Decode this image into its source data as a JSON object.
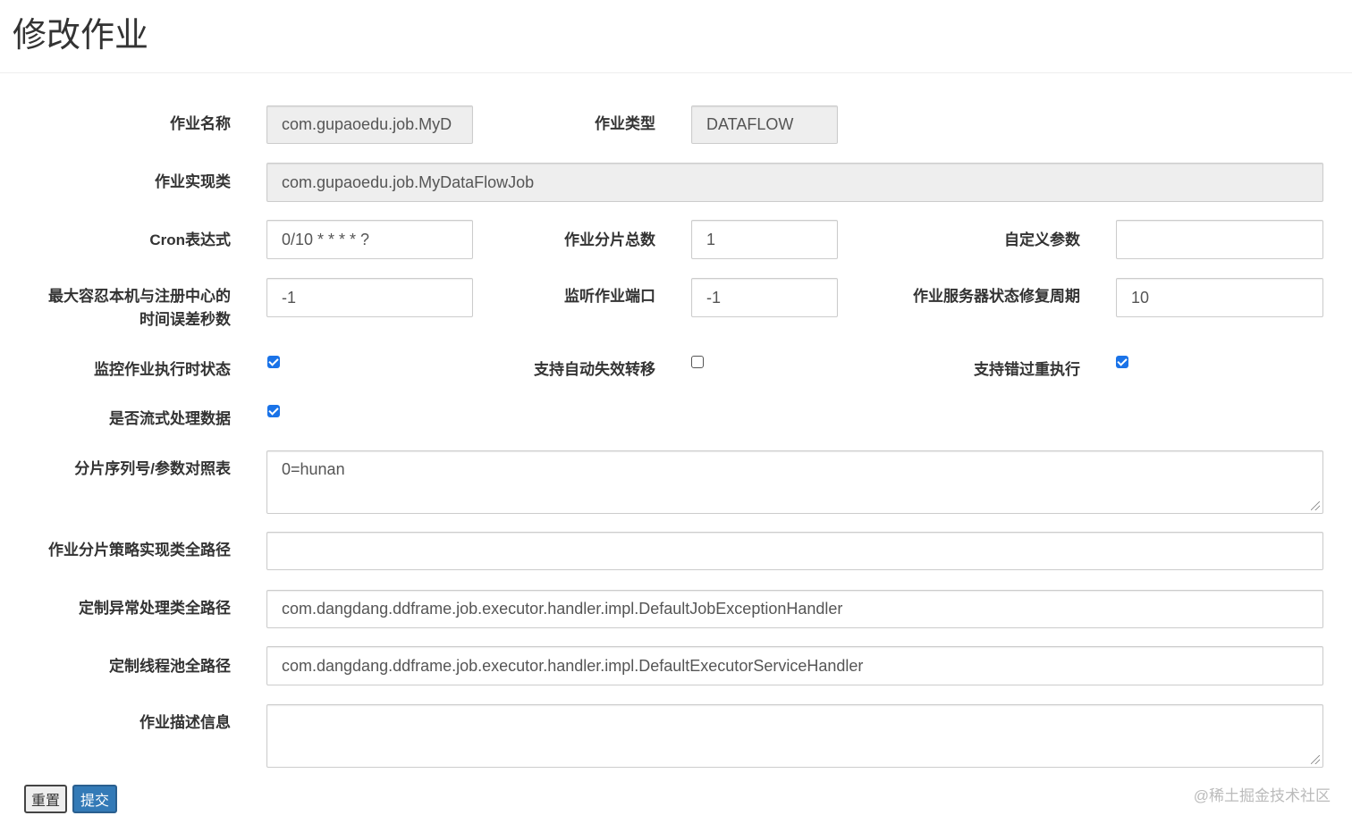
{
  "page": {
    "title": "修改作业"
  },
  "form": {
    "job_name": {
      "label": "作业名称",
      "value": "com.gupaoedu.job.MyD"
    },
    "job_type": {
      "label": "作业类型",
      "value": "DATAFLOW"
    },
    "job_class": {
      "label": "作业实现类",
      "value": "com.gupaoedu.job.MyDataFlowJob"
    },
    "cron": {
      "label": "Cron表达式",
      "value": "0/10 * * * * ?"
    },
    "sharding_total": {
      "label": "作业分片总数",
      "value": "1"
    },
    "job_parameter": {
      "label": "自定义参数",
      "value": ""
    },
    "max_time_diff": {
      "label_line1": "最大容忍本机与注册中心的",
      "label_line2": "时间误差秒数",
      "value": "-1"
    },
    "monitor_port": {
      "label": "监听作业端口",
      "value": "-1"
    },
    "reconcile_interval": {
      "label": "作业服务器状态修复周期",
      "value": "10"
    },
    "monitor_execution": {
      "label": "监控作业执行时状态",
      "checked": true
    },
    "failover": {
      "label": "支持自动失效转移",
      "checked": false
    },
    "misfire": {
      "label": "支持错过重执行",
      "checked": true
    },
    "streaming": {
      "label": "是否流式处理数据",
      "checked": true
    },
    "sharding_params": {
      "label": "分片序列号/参数对照表",
      "value": "0=hunan"
    },
    "sharding_strategy": {
      "label": "作业分片策略实现类全路径",
      "value": ""
    },
    "exception_handler": {
      "label": "定制异常处理类全路径",
      "value": "com.dangdang.ddframe.job.executor.handler.impl.DefaultJobExceptionHandler"
    },
    "executor_service": {
      "label": "定制线程池全路径",
      "value": "com.dangdang.ddframe.job.executor.handler.impl.DefaultExecutorServiceHandler"
    },
    "description": {
      "label": "作业描述信息",
      "value": ""
    }
  },
  "buttons": {
    "reset": "重置",
    "submit": "提交"
  },
  "watermark": "@稀土掘金技术社区"
}
